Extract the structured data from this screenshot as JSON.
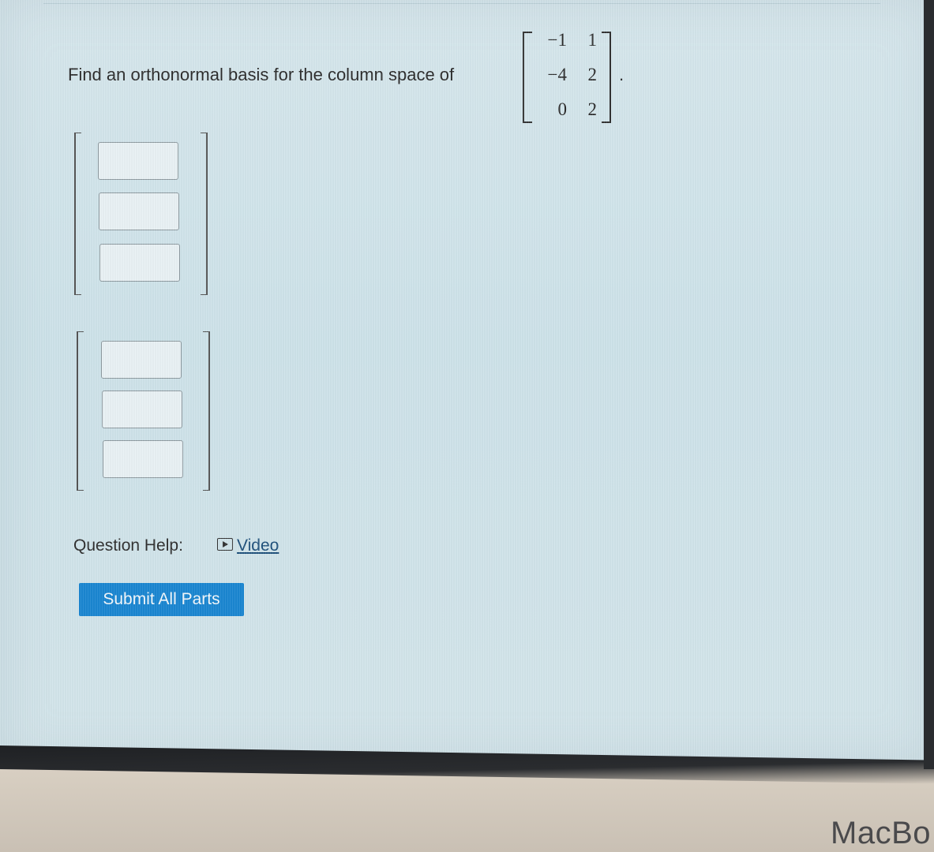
{
  "question": {
    "prompt": "Find an orthonormal basis for the column space of",
    "period": ".",
    "matrix": [
      [
        "−1",
        "1"
      ],
      [
        "−4",
        "2"
      ],
      [
        "0",
        "2"
      ]
    ]
  },
  "answer_vectors": [
    {
      "entries": [
        "",
        "",
        ""
      ]
    },
    {
      "entries": [
        "",
        "",
        ""
      ]
    }
  ],
  "help": {
    "label": "Question Help:",
    "video_label": "Video",
    "video_icon": "play-icon"
  },
  "submit": {
    "label": "Submit All Parts",
    "color": "#1a86d1"
  },
  "device": {
    "brand": "MacBo"
  }
}
